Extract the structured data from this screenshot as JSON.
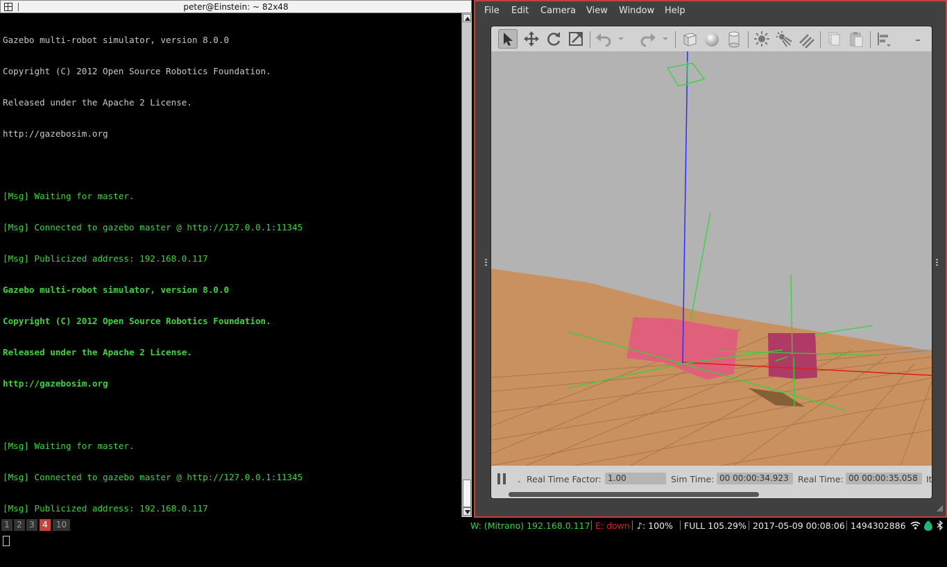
{
  "terminal": {
    "title": "peter@Einstein: ~ 82x48",
    "lines": [
      {
        "text": "Gazebo multi-robot simulator, version 8.0.0",
        "style": "grey"
      },
      {
        "text": "Copyright (C) 2012 Open Source Robotics Foundation.",
        "style": "grey"
      },
      {
        "text": "Released under the Apache 2 License.",
        "style": "grey"
      },
      {
        "text": "http://gazebosim.org",
        "style": "grey"
      },
      {
        "text": "",
        "style": "grey"
      },
      {
        "text": "[Msg] Waiting for master.",
        "style": "green"
      },
      {
        "text": "[Msg] Connected to gazebo master @ http://127.0.0.1:11345",
        "style": "green"
      },
      {
        "text": "[Msg] Publicized address: 192.168.0.117",
        "style": "green"
      },
      {
        "text": "Gazebo multi-robot simulator, version 8.0.0",
        "style": "green bold"
      },
      {
        "text": "Copyright (C) 2012 Open Source Robotics Foundation.",
        "style": "green bold"
      },
      {
        "text": "Released under the Apache 2 License.",
        "style": "green bold"
      },
      {
        "text": "http://gazebosim.org",
        "style": "green bold"
      },
      {
        "text": "",
        "style": "green"
      },
      {
        "text": "[Msg] Waiting for master.",
        "style": "green"
      },
      {
        "text": "[Msg] Connected to gazebo master @ http://127.0.0.1:11345",
        "style": "green"
      },
      {
        "text": "[Msg] Publicized address: 192.168.0.117",
        "style": "green"
      }
    ]
  },
  "gazebo": {
    "menu": [
      "File",
      "Edit",
      "Camera",
      "View",
      "Window",
      "Help"
    ],
    "toolbar_icons": [
      "select-arrow-icon",
      "translate-icon",
      "rotate-icon",
      "scale-icon",
      "undo-icon",
      "undo-history-icon",
      "redo-icon",
      "redo-history-icon",
      "box-icon",
      "sphere-icon",
      "cylinder-icon",
      "point-light-icon",
      "spot-light-icon",
      "directional-light-icon",
      "copy-icon",
      "paste-icon",
      "align-icon",
      "snap-icon"
    ],
    "bottom": {
      "step_label": "-",
      "rtf_label": "Real Time Factor:",
      "rtf_value": "1.00",
      "sim_label": "Sim Time:",
      "sim_value": "00 00:00:34.923",
      "real_label": "Real Time:",
      "real_value": "00 00:00:35.058",
      "iter_label": "It"
    },
    "colors": {
      "ground": "#c8915f",
      "sky": "#b3b3b3",
      "box": "#b03a66",
      "box_light": "#e0607c"
    }
  },
  "statusbar": {
    "workspaces": [
      "1",
      "2",
      "3",
      "4",
      "10"
    ],
    "active_workspace": "4",
    "wifi": "W: (Mitrano) 192.168.0.117",
    "ethernet": "E: down",
    "volume": "♪: 100%",
    "battery": "FULL 105.29%",
    "datetime": "2017-05-09 00:08:06",
    "epoch": "1494302886",
    "tray_icons": [
      "wifi-icon",
      "dropbox-icon",
      "bluetooth-icon"
    ]
  }
}
